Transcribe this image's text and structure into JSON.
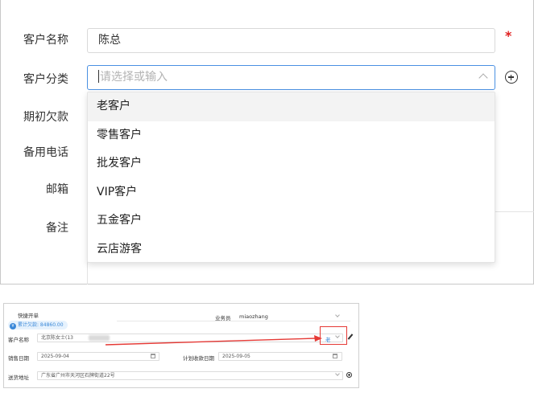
{
  "form": {
    "customer_name_label": "客户名称",
    "customer_name_value": "陈总",
    "required_mark": "*",
    "customer_category_label": "客户分类",
    "customer_category_placeholder": "请选择或输入",
    "opening_debt_label": "期初欠款",
    "backup_phone_label": "备用电话",
    "email_label": "邮箱",
    "remark_label": "备注"
  },
  "dropdown": {
    "options": [
      "老客户",
      "零售客户",
      "批发客户",
      "VIP客户",
      "五金客户",
      "云店游客"
    ],
    "highlighted_index": 0
  },
  "icons": {
    "dropdown_toggle": "chevron-up-icon",
    "add_category": "add-circle-icon"
  },
  "quick_order": {
    "title": "快捷开单",
    "salesperson_label": "业务员",
    "salesperson_value": "miaozhang",
    "debt_badge_icon": "¥",
    "debt_badge_text": "累计欠款: 84860.00",
    "customer_name_label": "客户名称",
    "customer_name_value": "北京陈女士(13",
    "customer_tag_value": "老",
    "sale_date_label": "销售日期",
    "sale_date_value": "2025-09-04",
    "planned_collection_label": "计划收款日期",
    "planned_collection_value": "2025-09-05",
    "delivery_address_label": "送货地址",
    "delivery_address_value": "广东省广州市天河区石牌街道22号"
  },
  "colors": {
    "input_focus_border": "#4a90e2",
    "required_star": "#e02020",
    "highlight_box": "#e53935",
    "badge_text": "#3a88d8"
  }
}
